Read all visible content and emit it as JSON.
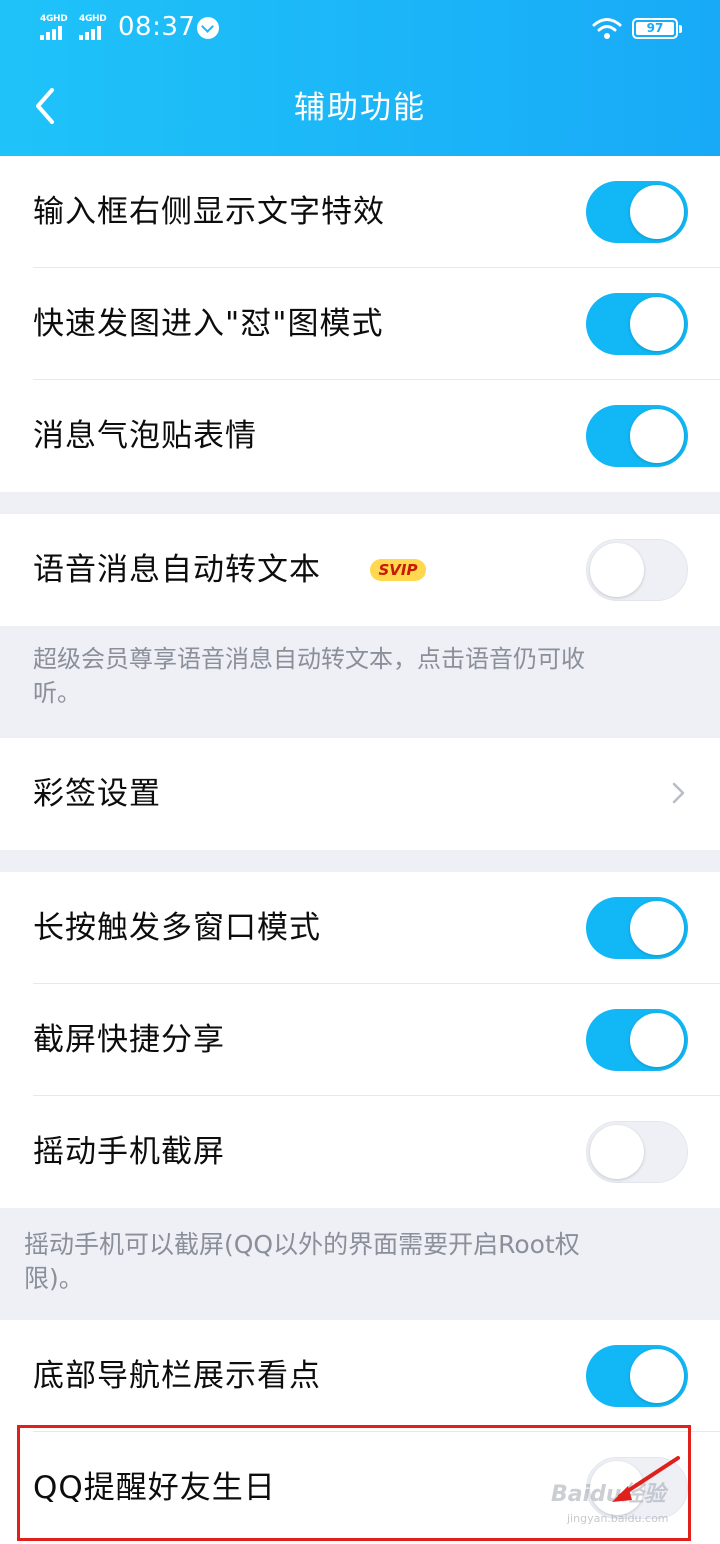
{
  "status_bar": {
    "network_1": "4GHD",
    "network_2": "4GHD",
    "time": "08:37",
    "battery": "97"
  },
  "header": {
    "title": "辅助功能"
  },
  "settings": [
    {
      "label": "输入框右侧显示文字特效",
      "toggle": "on"
    },
    {
      "label": "快速发图进入\"怼\"图模式",
      "toggle": "on"
    },
    {
      "label": "消息气泡贴表情",
      "toggle": "on"
    },
    {
      "label": "语音消息自动转文本",
      "toggle": "off",
      "badge": "SVIP"
    },
    {
      "label": "彩签设置"
    },
    {
      "label": "长按触发多窗口模式",
      "toggle": "on"
    },
    {
      "label": "截屏快捷分享",
      "toggle": "on"
    },
    {
      "label": "摇动手机截屏",
      "toggle": "off"
    },
    {
      "label": "底部导航栏展示看点",
      "toggle": "on"
    },
    {
      "label": "QQ提醒好友生日",
      "toggle": "off"
    }
  ],
  "notes": {
    "voice_note_line1": "超级会员尊享语音消息自动转文本，点击语音仍可收",
    "voice_note_line2": "听。",
    "shake_note_line1": "摇动手机可以截屏(QQ以外的界面需要开启Root权",
    "shake_note_line2": "限)。"
  },
  "watermark": {
    "brand": "Baidu经验",
    "url": "jingyan.baidu.com"
  },
  "colors": {
    "accent": "#12b7f5",
    "highlight_border": "#e0201a",
    "svip_badge": "#ffd84f"
  },
  "icons": {
    "back": "back-arrow-icon",
    "chevron": "chevron-right-icon",
    "wifi": "wifi-icon",
    "battery": "battery-icon",
    "clock": "alarm-icon"
  }
}
